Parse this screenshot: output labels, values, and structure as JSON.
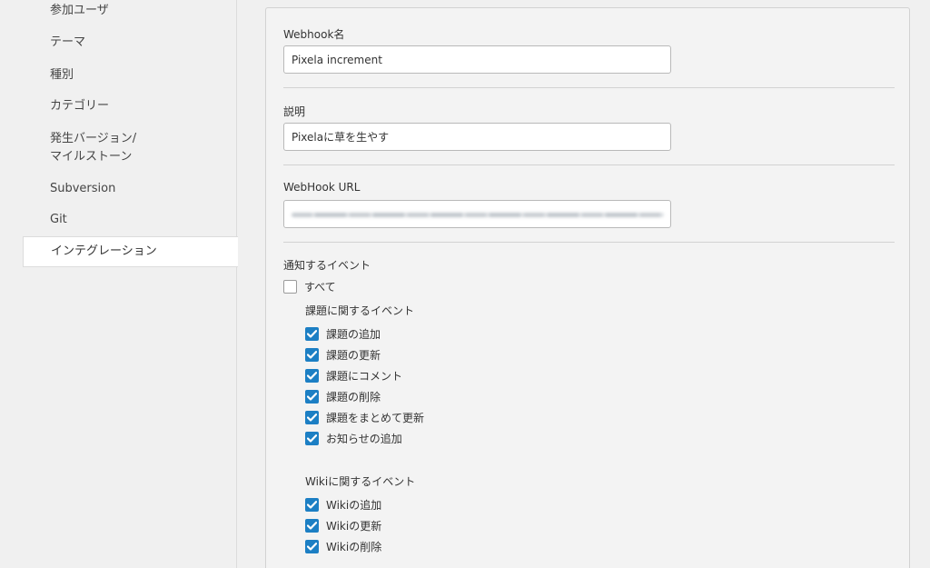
{
  "sidebar": {
    "items": [
      {
        "label": "参加ユーザ"
      },
      {
        "label": "テーマ"
      },
      {
        "label": "種別"
      },
      {
        "label": "カテゴリー"
      },
      {
        "label": "発生バージョン/"
      },
      {
        "label": "マイルストーン"
      },
      {
        "label": "Subversion"
      },
      {
        "label": "Git"
      },
      {
        "label": "インテグレーション"
      }
    ]
  },
  "form": {
    "name_label": "Webhook名",
    "name_value": "Pixela increment",
    "desc_label": "説明",
    "desc_value": "Pixelaに草を生やす",
    "url_label": "WebHook URL",
    "events_label": "通知するイベント",
    "all_label": "すべて",
    "all_checked": false,
    "issue_group": {
      "title": "課題に関するイベント",
      "items": [
        {
          "label": "課題の追加",
          "checked": true
        },
        {
          "label": "課題の更新",
          "checked": true
        },
        {
          "label": "課題にコメント",
          "checked": true
        },
        {
          "label": "課題の削除",
          "checked": true
        },
        {
          "label": "課題をまとめて更新",
          "checked": true
        },
        {
          "label": "お知らせの追加",
          "checked": true
        }
      ]
    },
    "wiki_group": {
      "title": "Wikiに関するイベント",
      "items": [
        {
          "label": "Wikiの追加",
          "checked": true
        },
        {
          "label": "Wikiの更新",
          "checked": true
        },
        {
          "label": "Wikiの削除",
          "checked": true
        }
      ]
    }
  },
  "colors": {
    "checkbox_accent": "#1c7fc4",
    "panel_bg": "#f3f3f3",
    "page_bg": "#f0f0f0"
  }
}
